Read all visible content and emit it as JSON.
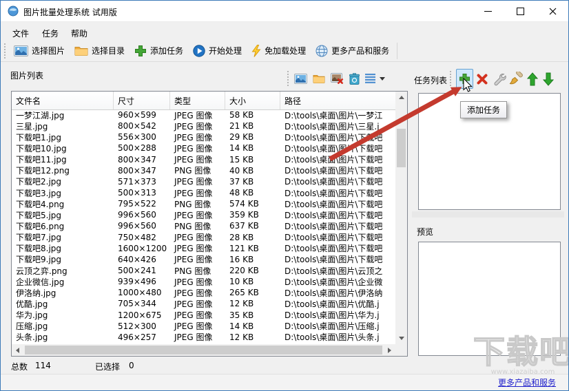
{
  "window": {
    "title": "图片批量处理系统 试用版"
  },
  "menu": {
    "items": [
      {
        "label": "文件"
      },
      {
        "label": "任务"
      },
      {
        "label": "帮助"
      }
    ]
  },
  "toolbar": {
    "items": [
      {
        "icon": "select-images-icon",
        "label": "选择图片"
      },
      {
        "icon": "select-folder-icon",
        "label": "选择目录"
      },
      {
        "icon": "add-task-icon",
        "label": "添加任务"
      },
      {
        "icon": "start-process-icon",
        "label": "开始处理"
      },
      {
        "icon": "lightning-icon",
        "label": "免加载处理"
      },
      {
        "icon": "globe-icon",
        "label": "更多产品和服务"
      }
    ]
  },
  "image_list_panel": {
    "title": "图片列表",
    "mini_toolbar_icons": [
      "add-images-icon",
      "add-folder-icon",
      "remove-image-icon",
      "clear-list-icon",
      "list-view-icon",
      "dropdown-arrow-icon"
    ],
    "table": {
      "headers": [
        "文件名",
        "尺寸",
        "类型",
        "大小",
        "路径"
      ],
      "rows": [
        {
          "name": "一梦江湖.jpg",
          "dim": "960×599",
          "type": "JPEG 图像",
          "size": "58 KB",
          "path": "D:\\tools\\桌面\\图片\\一梦江"
        },
        {
          "name": "三星.jpg",
          "dim": "800×542",
          "type": "JPEG 图像",
          "size": "21 KB",
          "path": "D:\\tools\\桌面\\图片\\三星.j"
        },
        {
          "name": "下载吧1.jpg",
          "dim": "556×300",
          "type": "JPEG 图像",
          "size": "29 KB",
          "path": "D:\\tools\\桌面\\图片\\下载吧"
        },
        {
          "name": "下载吧10.jpg",
          "dim": "500×288",
          "type": "JPEG 图像",
          "size": "14 KB",
          "path": "D:\\tools\\桌面\\图片\\下载吧"
        },
        {
          "name": "下载吧11.jpg",
          "dim": "800×347",
          "type": "JPEG 图像",
          "size": "15 KB",
          "path": "D:\\tools\\桌面\\图片\\下载吧"
        },
        {
          "name": "下载吧12.png",
          "dim": "800×347",
          "type": "PNG 图像",
          "size": "40 KB",
          "path": "D:\\tools\\桌面\\图片\\下载吧"
        },
        {
          "name": "下载吧2.jpg",
          "dim": "571×373",
          "type": "JPEG 图像",
          "size": "37 KB",
          "path": "D:\\tools\\桌面\\图片\\下载吧"
        },
        {
          "name": "下载吧3.jpg",
          "dim": "500×313",
          "type": "JPEG 图像",
          "size": "48 KB",
          "path": "D:\\tools\\桌面\\图片\\下载吧"
        },
        {
          "name": "下载吧4.png",
          "dim": "795×522",
          "type": "PNG 图像",
          "size": "574 KB",
          "path": "D:\\tools\\桌面\\图片\\下载吧"
        },
        {
          "name": "下载吧5.jpg",
          "dim": "996×560",
          "type": "JPEG 图像",
          "size": "359 KB",
          "path": "D:\\tools\\桌面\\图片\\下载吧"
        },
        {
          "name": "下载吧6.png",
          "dim": "996×560",
          "type": "PNG 图像",
          "size": "637 KB",
          "path": "D:\\tools\\桌面\\图片\\下载吧"
        },
        {
          "name": "下载吧7.jpg",
          "dim": "750×482",
          "type": "JPEG 图像",
          "size": "28 KB",
          "path": "D:\\tools\\桌面\\图片\\下载吧"
        },
        {
          "name": "下载吧8.jpg",
          "dim": "1600×1200",
          "type": "JPEG 图像",
          "size": "121 KB",
          "path": "D:\\tools\\桌面\\图片\\下载吧"
        },
        {
          "name": "下载吧9.jpg",
          "dim": "640×426",
          "type": "JPEG 图像",
          "size": "16 KB",
          "path": "D:\\tools\\桌面\\图片\\下载吧"
        },
        {
          "name": "云顶之弈.png",
          "dim": "500×241",
          "type": "PNG 图像",
          "size": "220 KB",
          "path": "D:\\tools\\桌面\\图片\\云顶之"
        },
        {
          "name": "企业微信.jpg",
          "dim": "939×496",
          "type": "JPEG 图像",
          "size": "10 KB",
          "path": "D:\\tools\\桌面\\图片\\企业微"
        },
        {
          "name": "伊洛纳.jpg",
          "dim": "1000×480",
          "type": "JPEG 图像",
          "size": "265 KB",
          "path": "D:\\tools\\桌面\\图片\\伊洛纳"
        },
        {
          "name": "优酷.jpg",
          "dim": "705×344",
          "type": "JPEG 图像",
          "size": "12 KB",
          "path": "D:\\tools\\桌面\\图片\\优酷.j"
        },
        {
          "name": "华为.jpg",
          "dim": "1200×675",
          "type": "JPEG 图像",
          "size": "35 KB",
          "path": "D:\\tools\\桌面\\图片\\华为.j"
        },
        {
          "name": "压缩.jpg",
          "dim": "512×300",
          "type": "JPEG 图像",
          "size": "14 KB",
          "path": "D:\\tools\\桌面\\图片\\压缩.j"
        },
        {
          "name": "头条.jpg",
          "dim": "496×257",
          "type": "JPEG 图像",
          "size": "12 KB",
          "path": "D:\\tools\\桌面\\图片\\头条.j"
        }
      ]
    },
    "status": {
      "total_label": "总数",
      "total_value": "114",
      "selected_label": "已选择",
      "selected_value": "0"
    }
  },
  "task_panel": {
    "title": "任务列表",
    "toolbar_icons": [
      "add-task-icon",
      "delete-task-icon",
      "wrench-icon",
      "brush-icon",
      "move-up-icon",
      "move-down-icon"
    ],
    "tooltip": "添加任务"
  },
  "preview_panel": {
    "title": "预览"
  },
  "footer": {
    "link": "更多产品和服务"
  },
  "watermark": {
    "text": "下载吧",
    "subtext": "www.xiazaiba.com"
  },
  "colors": {
    "accent_border": "#3d7ab8",
    "arrow_red": "#c43a2e",
    "link_blue": "#2222cc",
    "button_highlight": "#cfe8fb"
  }
}
